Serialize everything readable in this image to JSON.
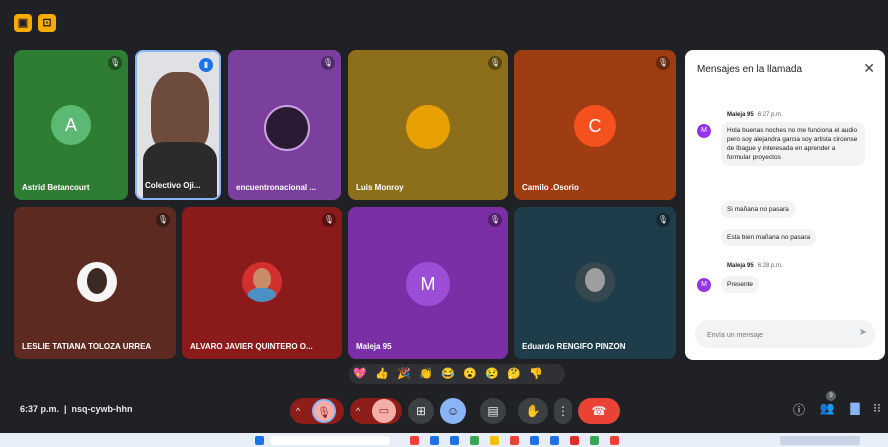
{
  "participants": [
    {
      "name": "Astrid Betancourt",
      "initial": "A",
      "bg": "#2e7d32",
      "avatar_color": "#5bb974"
    },
    {
      "name": "Colectivo Oji...",
      "bg": "#e8eaed"
    },
    {
      "name": "encuentronacional ...",
      "bg": "#7b3f9e"
    },
    {
      "name": "Luis Monroy",
      "bg": "#8d6e1a",
      "avatar_color": "#e8a000"
    },
    {
      "name": "Camilo .Osorio",
      "initial": "C",
      "bg": "#9e3c12",
      "avatar_color": "#f4511e"
    },
    {
      "name": "LESLIE TATIANA TOLOZA URREA",
      "bg": "#5d2a22"
    },
    {
      "name": "ALVARO JAVIER QUINTERO O...",
      "bg": "#8b1a1a"
    },
    {
      "name": "Maleja 95",
      "initial": "M",
      "bg": "#7b2fa6",
      "avatar_color": "#9c4fd6"
    },
    {
      "name": "Eduardo RENGIFO PINZON",
      "bg": "#1f3c4a"
    }
  ],
  "chat": {
    "title": "Mensajes en la llamada",
    "messages": [
      {
        "sender": "Maleja 95",
        "time": "6:27 p.m.",
        "text": "Hola buenas noches no me funciona el audio pero soy alejandra garcia soy artista circense de Ibague y interesada en aprender a formular proyectos"
      },
      {
        "text": "Si mañana no pasara"
      },
      {
        "text": "Esta bien mañana no pasara"
      },
      {
        "sender": "Maleja 95",
        "time": "6:28 p.m.",
        "text": "Presente"
      }
    ],
    "input_placeholder": "Envía un mensaje"
  },
  "reactions": [
    "💖",
    "👍",
    "🎉",
    "👏",
    "😂",
    "😮",
    "😢",
    "🤔",
    "👎"
  ],
  "meeting": {
    "time": "6:37 p.m.",
    "code": "nsq-cywb-hhn",
    "people_count": "9"
  },
  "colors": {
    "end_call": "#ea4335",
    "accent": "#8ab4f8",
    "muted_red": "#8c1d18"
  }
}
